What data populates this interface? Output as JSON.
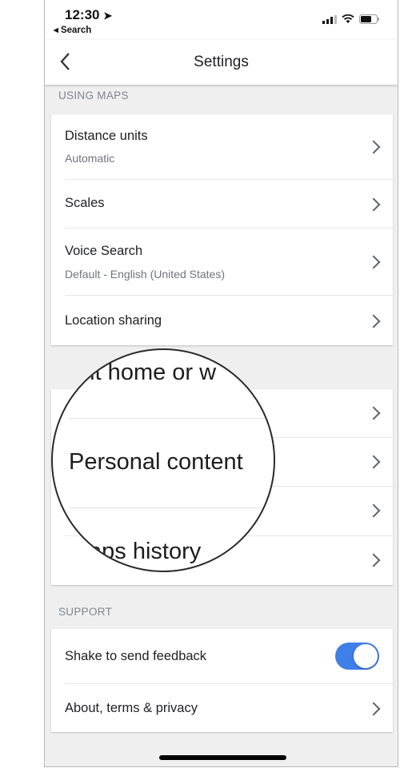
{
  "status_bar": {
    "time": "12:30",
    "back_app": "◂ Search",
    "icons": [
      "location-arrow-icon",
      "signal-icon",
      "wifi-icon",
      "battery-icon"
    ]
  },
  "header": {
    "title": "Settings",
    "back_icon": "chevron-left-icon"
  },
  "sections": [
    {
      "label": "USING MAPS",
      "items": [
        {
          "label": "Distance units",
          "sub": "Automatic"
        },
        {
          "label": "Scales"
        },
        {
          "label": "Voice Search",
          "sub": "Default - English (United States)"
        },
        {
          "label": "Location sharing"
        }
      ]
    },
    {
      "items": [
        {},
        {},
        {},
        {}
      ]
    },
    {
      "label": "SUPPORT",
      "items": [
        {
          "label": "Shake to send feedback",
          "toggle": true
        },
        {
          "label": "About, terms & privacy"
        }
      ]
    }
  ],
  "magnifier": {
    "lines": [
      "ult home or w",
      "Personal content",
      "aps history"
    ]
  },
  "colors": {
    "toggle_on": "#3f7fe8",
    "background": "#efefef"
  }
}
